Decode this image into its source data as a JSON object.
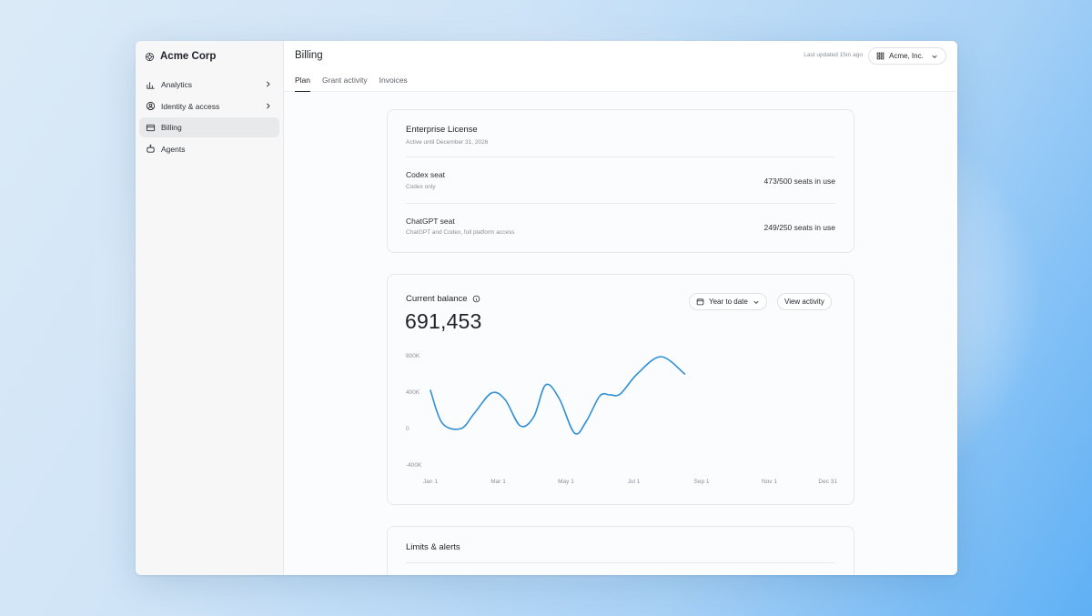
{
  "sidebar": {
    "org_name": "Acme Corp",
    "items": [
      {
        "label": "Analytics",
        "icon": "bar-chart-icon",
        "has_chevron": true
      },
      {
        "label": "Identity & access",
        "icon": "user-circle-icon",
        "has_chevron": true
      },
      {
        "label": "Billing",
        "icon": "credit-card-icon",
        "has_chevron": false,
        "active": true
      },
      {
        "label": "Agents",
        "icon": "robot-icon",
        "has_chevron": false
      }
    ]
  },
  "header": {
    "title": "Billing",
    "last_updated": "Last updated 15m ago",
    "org_switcher": "Acme, Inc.",
    "tabs": [
      {
        "label": "Plan",
        "active": true
      },
      {
        "label": "Grant activity"
      },
      {
        "label": "Invoices"
      }
    ]
  },
  "license": {
    "title": "Enterprise License",
    "subtitle": "Active until December 31, 2026",
    "seats": [
      {
        "name": "Codex seat",
        "desc": "Codex only",
        "usage": "473/500 seats in use"
      },
      {
        "name": "ChatGPT seat",
        "desc": "ChatGPT and Codex, full platform access",
        "usage": "249/250 seats in use"
      }
    ]
  },
  "balance": {
    "label": "Current balance",
    "value": "691,453",
    "range_button": "Year to date",
    "view_button": "View activity"
  },
  "limits": {
    "title": "Limits & alerts"
  },
  "colors": {
    "line": "#2f8fd6",
    "accent_text": "#1f2328"
  },
  "chart_data": {
    "type": "line",
    "y_ticks": [
      "800K",
      "400K",
      "0",
      "-400K"
    ],
    "x_ticks": [
      "Jan 1",
      "Mar 1",
      "May 1",
      "Jul 1",
      "Sep 1",
      "Nov 1",
      "Dec 31"
    ],
    "ylim": [
      -400000,
      800000
    ],
    "xlim": [
      0,
      12
    ],
    "grid": false,
    "series": [
      {
        "x": [
          0.0,
          0.35,
          0.9,
          1.3,
          1.8,
          2.2,
          2.65,
          3.05,
          3.4,
          3.8,
          4.25,
          4.6,
          5.0,
          5.3,
          5.6,
          6.1,
          6.8,
          7.5
        ],
        "y": [
          420000,
          60000,
          0,
          170000,
          390000,
          320000,
          30000,
          130000,
          480000,
          330000,
          -50000,
          80000,
          360000,
          370000,
          380000,
          600000,
          790000,
          600000
        ]
      }
    ]
  }
}
